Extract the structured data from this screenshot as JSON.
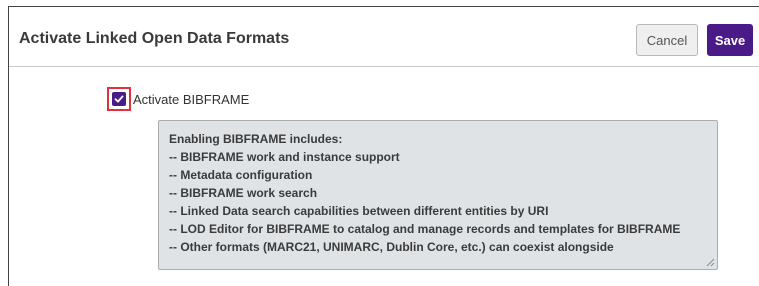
{
  "header": {
    "title": "Activate Linked Open Data Formats",
    "cancel_label": "Cancel",
    "save_label": "Save"
  },
  "checkbox": {
    "label": "Activate BIBFRAME",
    "checked": true
  },
  "info": {
    "lines": [
      "Enabling BIBFRAME includes:",
      "-- BIBFRAME work and instance support",
      "-- Metadata configuration",
      "-- BIBFRAME work search",
      "-- Linked Data search capabilities between different entities by URI",
      "-- LOD Editor for BIBFRAME to catalog and manage records and templates for BIBFRAME",
      "-- Other formats (MARC21, UNIMARC, Dublin Core, etc.) can coexist alongside"
    ]
  },
  "colors": {
    "accent": "#4a1a86",
    "highlight": "#e0303a",
    "info_background": "#dfe3e6"
  }
}
